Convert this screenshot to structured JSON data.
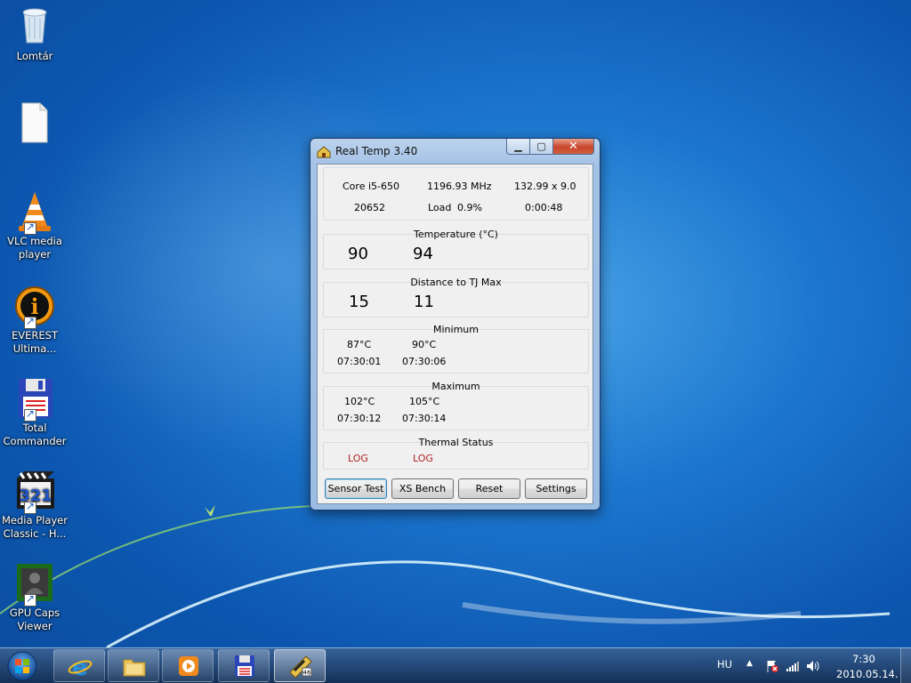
{
  "desktop": {
    "icons": [
      {
        "label": "Lomtár",
        "icon": "recycle-bin-icon"
      },
      {
        "label": "",
        "icon": "blank-document-icon"
      },
      {
        "label": "VLC media player",
        "icon": "vlc-cone-icon"
      },
      {
        "label": "EVEREST Ultima...",
        "icon": "everest-info-icon"
      },
      {
        "label": "Total Commander",
        "icon": "floppy-disk-icon"
      },
      {
        "label": "Media Player Classic - H...",
        "icon": "media-player-classic-icon"
      },
      {
        "label": "GPU Caps Viewer",
        "icon": "gpu-caps-viewer-icon"
      }
    ]
  },
  "window": {
    "title": "Real Temp 3.40",
    "cpu": {
      "model": "Core i5-650",
      "frequency": "1196.93 MHz",
      "multiplier": "132.99 x 9.0",
      "id": "20652",
      "load_label": "Load",
      "load_value": "0.9%",
      "time": "0:00:48"
    },
    "temperature": {
      "title": "Temperature (°C)",
      "core0": "90",
      "core1": "94"
    },
    "distance": {
      "title": "Distance to TJ Max",
      "core0": "15",
      "core1": "11"
    },
    "minimum": {
      "title": "Minimum",
      "core0_temp": "87°C",
      "core1_temp": "90°C",
      "core0_time": "07:30:01",
      "core1_time": "07:30:06"
    },
    "maximum": {
      "title": "Maximum",
      "core0_temp": "102°C",
      "core1_temp": "105°C",
      "core0_time": "07:30:12",
      "core1_time": "07:30:14"
    },
    "thermal": {
      "title": "Thermal Status",
      "core0": "LOG",
      "core1": "LOG"
    },
    "buttons": {
      "sensor_test": "Sensor Test",
      "xs_bench": "XS Bench",
      "reset": "Reset",
      "settings": "Settings"
    }
  },
  "taskbar": {
    "items": [
      "internet-explorer-icon",
      "windows-explorer-icon",
      "media-player-icon",
      "total-commander-icon",
      "real-temp-icon"
    ],
    "language": "HU",
    "time": "7:30",
    "date": "2010.05.14."
  },
  "colors": {
    "accent": "#1d77cf",
    "status_text": "#b22222"
  }
}
